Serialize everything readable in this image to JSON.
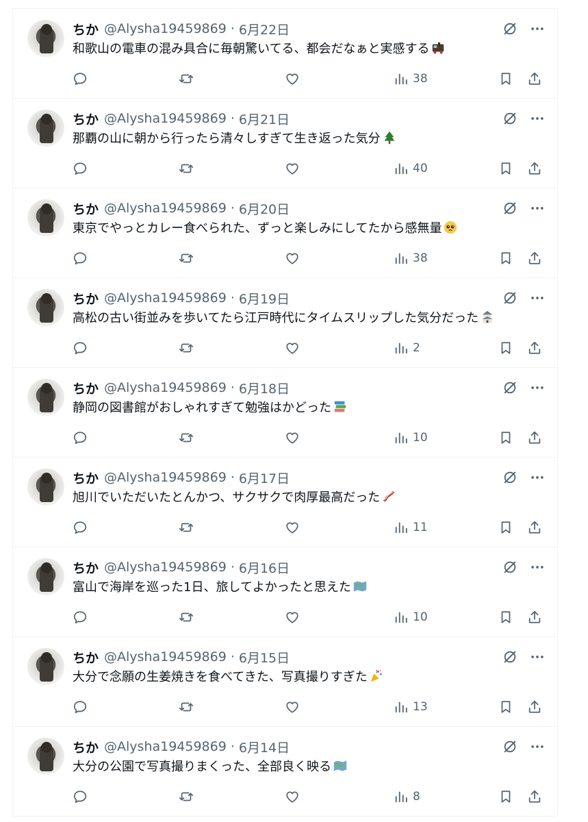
{
  "user": {
    "display_name": "ちか",
    "handle": "@Alysha19459869"
  },
  "separator": "·",
  "tweets": [
    {
      "date": "6月22日",
      "text": "和歌山の電車の混み具合に毎朝驚いてる、都会だなぁと実感する",
      "emoji": "train-emoji",
      "views": "38"
    },
    {
      "date": "6月21日",
      "text": "那覇の山に朝から行ったら清々しすぎて生き返った気分",
      "emoji": "tree-emoji",
      "views": "40"
    },
    {
      "date": "6月20日",
      "text": "東京でやっとカレー食べられた、ずっと楽しみにしてたから感無量",
      "emoji": "pleading-face-emoji",
      "views": "38"
    },
    {
      "date": "6月19日",
      "text": "高松の古い街並みを歩いてたら江戸時代にタイムスリップした気分だった",
      "emoji": "castle-emoji",
      "views": "2"
    },
    {
      "date": "6月18日",
      "text": "静岡の図書館がおしゃれすぎて勉強はかどった",
      "emoji": "books-emoji",
      "views": "10"
    },
    {
      "date": "6月17日",
      "text": "旭川でいただいたとんかつ、サクサクで肉厚最高だった",
      "emoji": "bacon-emoji",
      "views": "11"
    },
    {
      "date": "6月16日",
      "text": "富山で海岸を巡った1日、旅してよかったと思えた",
      "emoji": "map-emoji",
      "views": "10"
    },
    {
      "date": "6月15日",
      "text": "大分で念願の生姜焼きを食べてきた、写真撮りすぎた",
      "emoji": "party-popper-emoji",
      "views": "13"
    },
    {
      "date": "6月14日",
      "text": "大分の公園で写真撮りまくった、全部良く映る",
      "emoji": "map-emoji",
      "views": "8"
    }
  ]
}
